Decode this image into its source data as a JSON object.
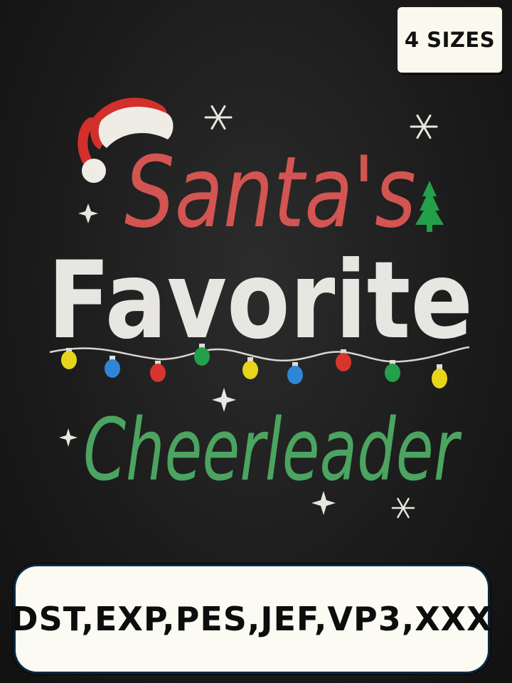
{
  "badge": {
    "label": "4 SIZES"
  },
  "design": {
    "line1": "Santa's",
    "line2": "Favorite",
    "line3": "Cheerleader",
    "colors": {
      "red": "#d6352e",
      "white": "#ecebe6",
      "green": "#23a04a",
      "background": "#1f1f1f"
    },
    "decorations": [
      "santa-hat-icon",
      "snowflake-icon",
      "christmas-tree-icon",
      "sparkle-icon",
      "string-lights"
    ]
  },
  "formats": {
    "label": "DST,EXP,PES,JEF,VP3,XXX"
  }
}
